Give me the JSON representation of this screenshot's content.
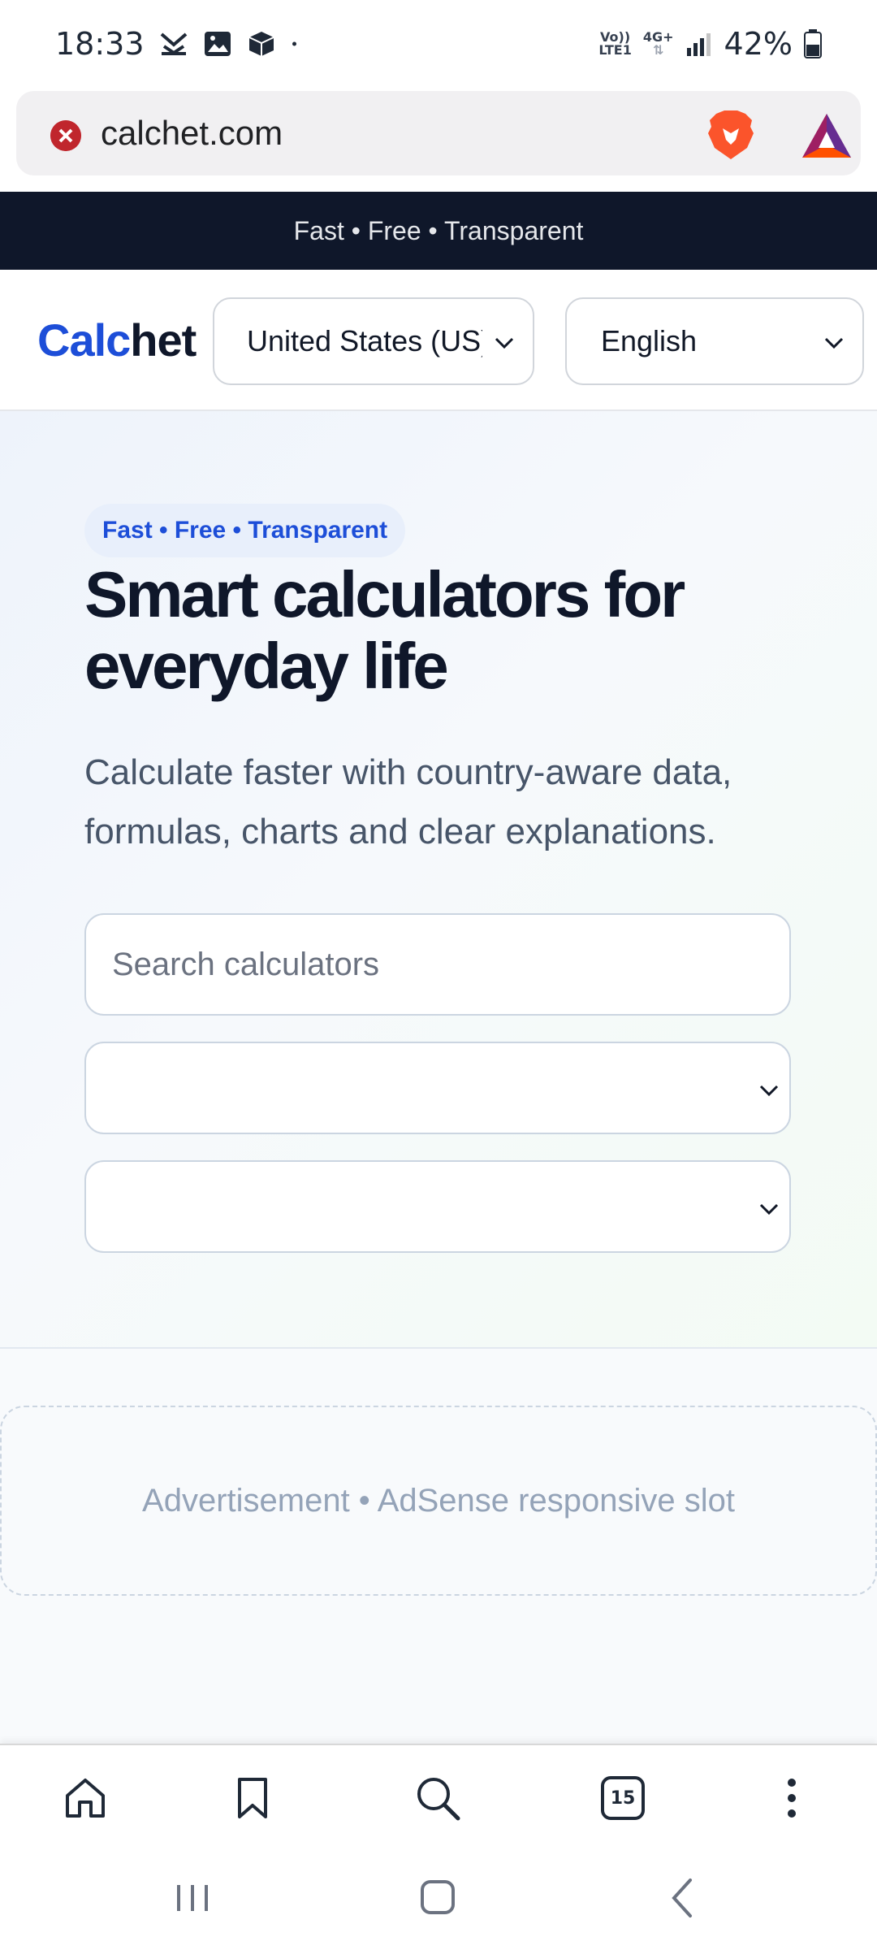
{
  "status_bar": {
    "time": "18:33",
    "network_top": "Vo))",
    "network_bottom": "LTE1",
    "network_type": "4G+",
    "battery": "42%"
  },
  "browser": {
    "url": "calchet.com",
    "tab_count": "15"
  },
  "banner": {
    "text": "Fast • Free • Transparent"
  },
  "header": {
    "logo_part1": "Calc",
    "logo_part2": "het",
    "country_value": "United States (US)",
    "language_value": "English"
  },
  "hero": {
    "pill": "Fast • Free • Transparent",
    "title": "Smart calculators for everyday life",
    "subtitle": "Calculate faster with country-aware data, formulas, charts and clear explanations.",
    "search_placeholder": "Search calculators"
  },
  "ad": {
    "text": "Advertisement • AdSense responsive slot"
  },
  "colors": {
    "brand_blue": "#1d4ed8",
    "dark_navy": "#0f172a",
    "brave_orange": "#fb542b"
  }
}
